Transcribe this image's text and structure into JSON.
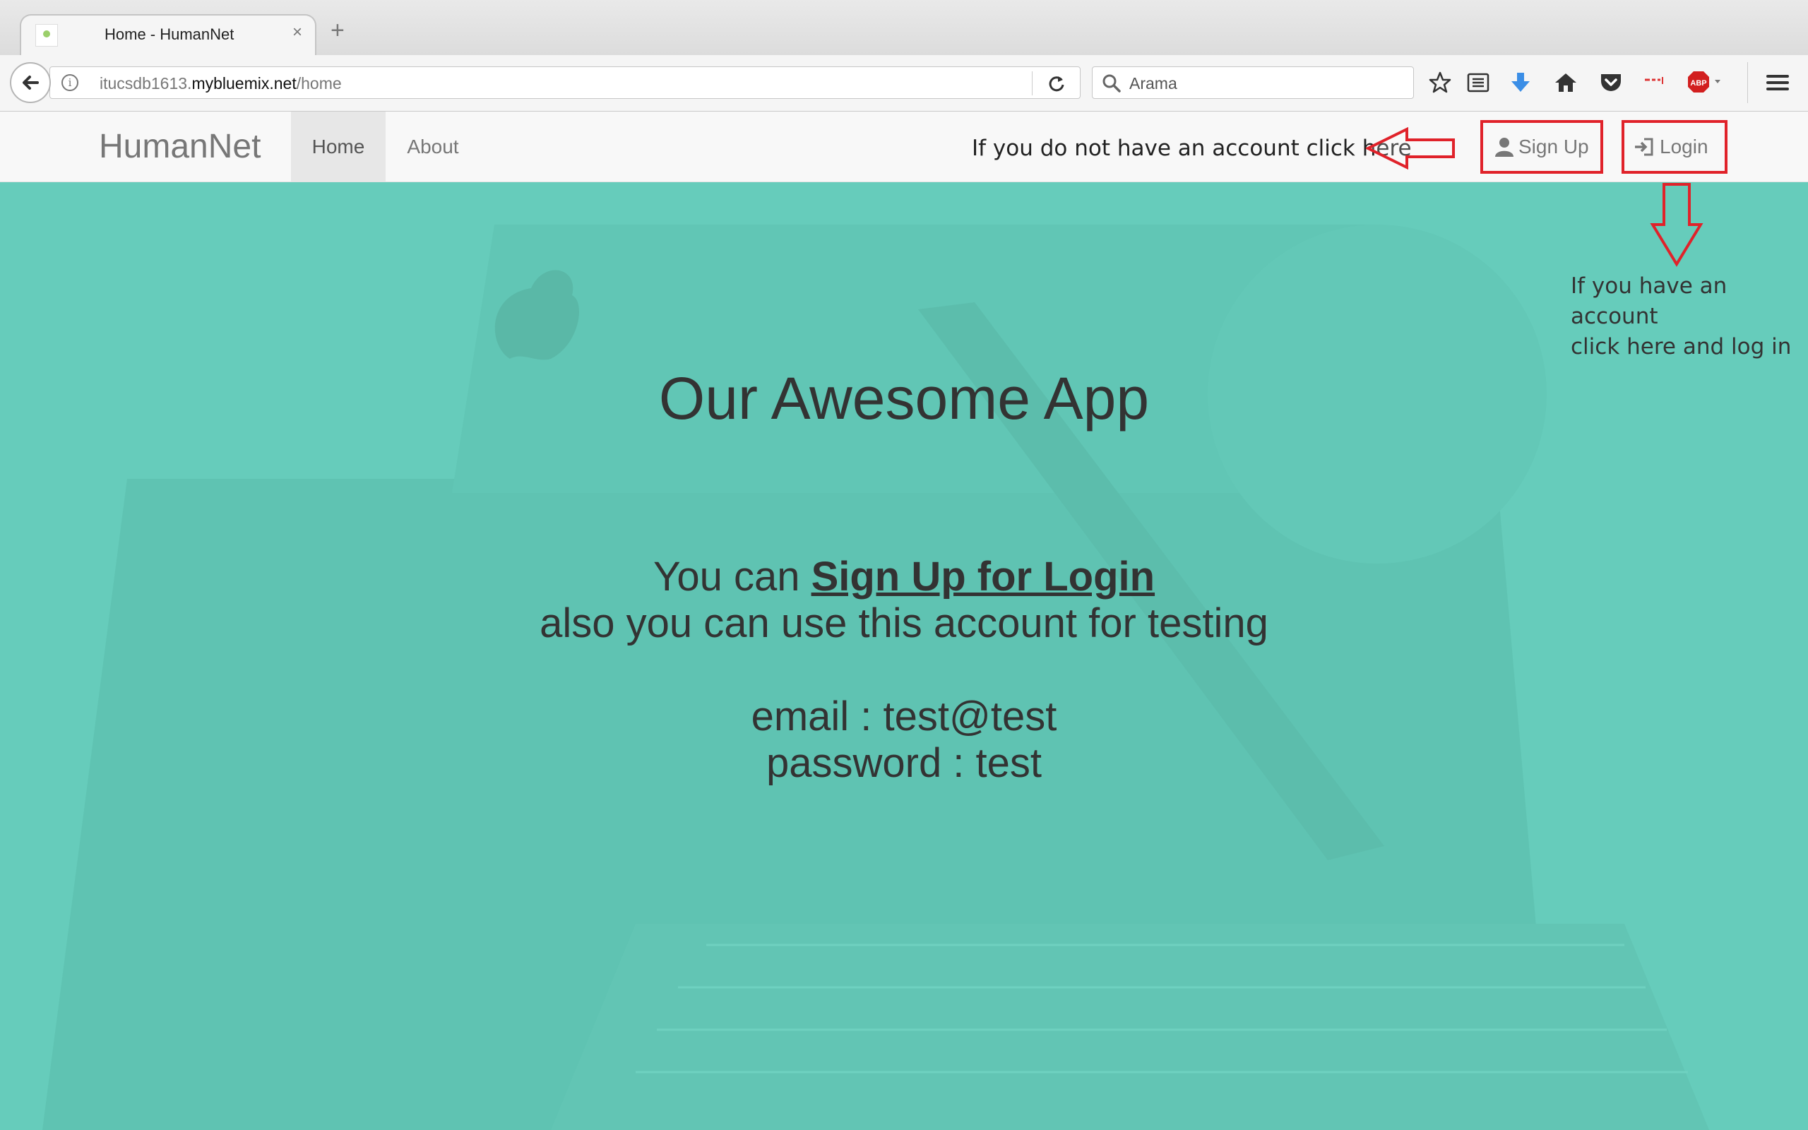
{
  "browser": {
    "tab_title": "Home - HumanNet",
    "tab_close": "×",
    "new_tab": "+",
    "url_prefix": "itucsdb1613.",
    "url_domain": "mybluemix.net",
    "url_path": "/home",
    "search_placeholder": "Arama",
    "toolbar_icons": [
      "star-icon",
      "reading-list-icon",
      "download-icon",
      "home-icon",
      "pocket-icon",
      "extension-icon",
      "adblock-icon",
      "menu-icon"
    ],
    "adblock_label": "ABP"
  },
  "site_nav": {
    "brand": "HumanNet",
    "home": "Home",
    "about": "About",
    "signup": "Sign Up",
    "login": "Login"
  },
  "annotations": {
    "signup_hint": "If you do not have an account click here",
    "login_hint_line1": "If you have an account",
    "login_hint_line2": "click here and log in",
    "color": "#e0222a"
  },
  "hero": {
    "title": "Our Awesome App",
    "line1_prefix": "You can ",
    "line1_link": "Sign Up for Login",
    "line2": "also you can use this account for testing",
    "email": "email : test@test",
    "password": "password : test",
    "background": "#66ccbb"
  }
}
